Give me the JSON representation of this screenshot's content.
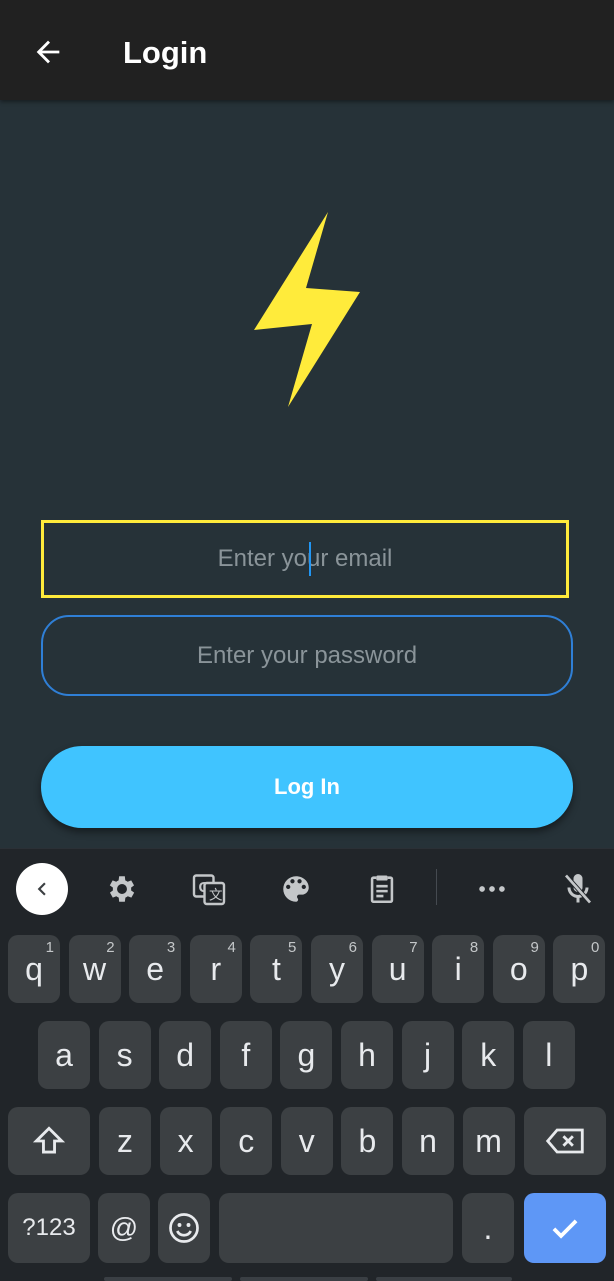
{
  "app_bar": {
    "title": "Login",
    "back_icon": "arrow-left-icon"
  },
  "logo": {
    "icon": "lightning-bolt-icon",
    "color": "#ffeb3b"
  },
  "form": {
    "email_placeholder": "Enter your email",
    "password_placeholder": "Enter your password",
    "login_label": "Log In"
  },
  "colors": {
    "background": "#263238",
    "appbar": "#212121",
    "email_border": "#ffeb3b",
    "password_border": "#2f7fd6",
    "button": "#40c4ff"
  },
  "keyboard": {
    "toolbar": [
      "chevron-left-icon",
      "gear-icon",
      "translate-icon",
      "palette-icon",
      "clipboard-icon",
      "more-horizontal-icon",
      "mic-off-icon"
    ],
    "row1": [
      {
        "key": "q",
        "hint": "1"
      },
      {
        "key": "w",
        "hint": "2"
      },
      {
        "key": "e",
        "hint": "3"
      },
      {
        "key": "r",
        "hint": "4"
      },
      {
        "key": "t",
        "hint": "5"
      },
      {
        "key": "y",
        "hint": "6"
      },
      {
        "key": "u",
        "hint": "7"
      },
      {
        "key": "i",
        "hint": "8"
      },
      {
        "key": "o",
        "hint": "9"
      },
      {
        "key": "p",
        "hint": "0"
      }
    ],
    "row2": [
      "a",
      "s",
      "d",
      "f",
      "g",
      "h",
      "j",
      "k",
      "l"
    ],
    "row3": [
      "z",
      "x",
      "c",
      "v",
      "b",
      "n",
      "m"
    ],
    "row4": {
      "symbols": "?123",
      "at": "@",
      "period": "."
    }
  }
}
